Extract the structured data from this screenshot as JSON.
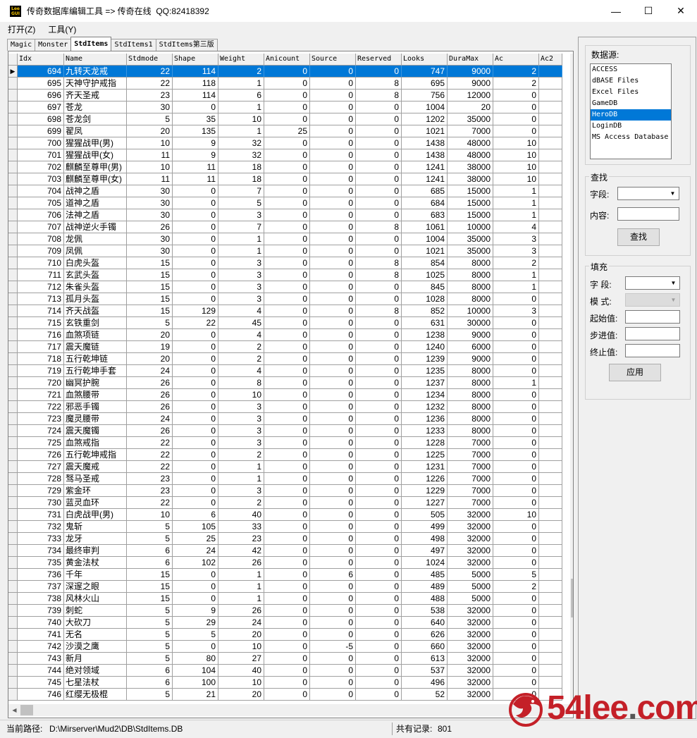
{
  "window": {
    "icon_text": "Lee\nGUI",
    "title": "传奇数据库编辑工具 => 传奇在线  QQ:82418392",
    "minimize": "—",
    "maximize": "☐",
    "close": "✕"
  },
  "menu": [
    "打开(Z)",
    "工具(Y)"
  ],
  "tabs": [
    {
      "label": "Magic",
      "active": false
    },
    {
      "label": "Monster",
      "active": false
    },
    {
      "label": "StdItems",
      "active": true
    },
    {
      "label": "StdItems1",
      "active": false
    },
    {
      "label": "StdItems第三版",
      "active": false
    }
  ],
  "grid": {
    "columns": [
      "Idx",
      "Name",
      "Stdmode",
      "Shape",
      "Weight",
      "Anicount",
      "Source",
      "Reserved",
      "Looks",
      "DuraMax",
      "Ac",
      "Ac2"
    ],
    "selected_row": 0,
    "rows": [
      [
        "694",
        "九转天龙戒",
        "22",
        "114",
        "2",
        "0",
        "0",
        "0",
        "747",
        "9000",
        "2"
      ],
      [
        "695",
        "天神守护戒指",
        "22",
        "118",
        "1",
        "0",
        "0",
        "8",
        "695",
        "9000",
        "2"
      ],
      [
        "696",
        "齐天圣戒",
        "23",
        "114",
        "6",
        "0",
        "0",
        "8",
        "756",
        "12000",
        "0"
      ],
      [
        "697",
        "苍龙",
        "30",
        "0",
        "1",
        "0",
        "0",
        "0",
        "1004",
        "20",
        "0"
      ],
      [
        "698",
        "苍龙剑",
        "5",
        "35",
        "10",
        "0",
        "0",
        "0",
        "1202",
        "35000",
        "0"
      ],
      [
        "699",
        "翟凤",
        "20",
        "135",
        "1",
        "25",
        "0",
        "0",
        "1021",
        "7000",
        "0"
      ],
      [
        "700",
        "猩猩战甲(男)",
        "10",
        "9",
        "32",
        "0",
        "0",
        "0",
        "1438",
        "48000",
        "10"
      ],
      [
        "701",
        "猩猩战甲(女)",
        "11",
        "9",
        "32",
        "0",
        "0",
        "0",
        "1438",
        "48000",
        "10"
      ],
      [
        "702",
        "麒麟至尊甲(男)",
        "10",
        "11",
        "18",
        "0",
        "0",
        "0",
        "1241",
        "38000",
        "10"
      ],
      [
        "703",
        "麒麟至尊甲(女)",
        "11",
        "11",
        "18",
        "0",
        "0",
        "0",
        "1241",
        "38000",
        "10"
      ],
      [
        "704",
        "战神之盾",
        "30",
        "0",
        "7",
        "0",
        "0",
        "0",
        "685",
        "15000",
        "1"
      ],
      [
        "705",
        "道神之盾",
        "30",
        "0",
        "5",
        "0",
        "0",
        "0",
        "684",
        "15000",
        "1"
      ],
      [
        "706",
        "法神之盾",
        "30",
        "0",
        "3",
        "0",
        "0",
        "0",
        "683",
        "15000",
        "1"
      ],
      [
        "707",
        "战神逆火手镯",
        "26",
        "0",
        "7",
        "0",
        "0",
        "8",
        "1061",
        "10000",
        "4"
      ],
      [
        "708",
        "龙佩",
        "30",
        "0",
        "1",
        "0",
        "0",
        "0",
        "1004",
        "35000",
        "3"
      ],
      [
        "709",
        "凤佩",
        "30",
        "0",
        "1",
        "0",
        "0",
        "0",
        "1021",
        "35000",
        "3"
      ],
      [
        "710",
        "白虎头盔",
        "15",
        "0",
        "3",
        "0",
        "0",
        "8",
        "854",
        "8000",
        "2"
      ],
      [
        "711",
        "玄武头盔",
        "15",
        "0",
        "3",
        "0",
        "0",
        "8",
        "1025",
        "8000",
        "1"
      ],
      [
        "712",
        "朱雀头盔",
        "15",
        "0",
        "3",
        "0",
        "0",
        "0",
        "845",
        "8000",
        "1"
      ],
      [
        "713",
        "孤月头盔",
        "15",
        "0",
        "3",
        "0",
        "0",
        "0",
        "1028",
        "8000",
        "0"
      ],
      [
        "714",
        "齐天战盔",
        "15",
        "129",
        "4",
        "0",
        "0",
        "8",
        "852",
        "10000",
        "3"
      ],
      [
        "715",
        "玄铁重剑",
        "5",
        "22",
        "45",
        "0",
        "0",
        "0",
        "631",
        "30000",
        "0"
      ],
      [
        "716",
        "血煞项链",
        "20",
        "0",
        "4",
        "0",
        "0",
        "0",
        "1238",
        "9000",
        "0"
      ],
      [
        "717",
        "震天魔链",
        "19",
        "0",
        "2",
        "0",
        "0",
        "0",
        "1240",
        "6000",
        "0"
      ],
      [
        "718",
        "五行乾坤链",
        "20",
        "0",
        "2",
        "0",
        "0",
        "0",
        "1239",
        "9000",
        "0"
      ],
      [
        "719",
        "五行乾坤手套",
        "24",
        "0",
        "4",
        "0",
        "0",
        "0",
        "1235",
        "8000",
        "0"
      ],
      [
        "720",
        "幽冥护腕",
        "26",
        "0",
        "8",
        "0",
        "0",
        "0",
        "1237",
        "8000",
        "1"
      ],
      [
        "721",
        "血煞腰带",
        "26",
        "0",
        "10",
        "0",
        "0",
        "0",
        "1234",
        "8000",
        "0"
      ],
      [
        "722",
        "邪恶手镯",
        "26",
        "0",
        "3",
        "0",
        "0",
        "0",
        "1232",
        "8000",
        "0"
      ],
      [
        "723",
        "魔灵腰带",
        "24",
        "0",
        "3",
        "0",
        "0",
        "0",
        "1236",
        "8000",
        "0"
      ],
      [
        "724",
        "震天魔镯",
        "26",
        "0",
        "3",
        "0",
        "0",
        "0",
        "1233",
        "8000",
        "0"
      ],
      [
        "725",
        "血煞戒指",
        "22",
        "0",
        "3",
        "0",
        "0",
        "0",
        "1228",
        "7000",
        "0"
      ],
      [
        "726",
        "五行乾坤戒指",
        "22",
        "0",
        "2",
        "0",
        "0",
        "0",
        "1225",
        "7000",
        "0"
      ],
      [
        "727",
        "震天魔戒",
        "22",
        "0",
        "1",
        "0",
        "0",
        "0",
        "1231",
        "7000",
        "0"
      ],
      [
        "728",
        "驽马圣戒",
        "23",
        "0",
        "1",
        "0",
        "0",
        "0",
        "1226",
        "7000",
        "0"
      ],
      [
        "729",
        "紫金环",
        "23",
        "0",
        "3",
        "0",
        "0",
        "0",
        "1229",
        "7000",
        "0"
      ],
      [
        "730",
        "蓝灵血环",
        "22",
        "0",
        "2",
        "0",
        "0",
        "0",
        "1227",
        "7000",
        "0"
      ],
      [
        "731",
        "白虎战甲(男)",
        "10",
        "6",
        "40",
        "0",
        "0",
        "0",
        "505",
        "32000",
        "10"
      ],
      [
        "732",
        "鬼斩",
        "5",
        "105",
        "33",
        "0",
        "0",
        "0",
        "499",
        "32000",
        "0"
      ],
      [
        "733",
        "龙牙",
        "5",
        "25",
        "23",
        "0",
        "0",
        "0",
        "498",
        "32000",
        "0"
      ],
      [
        "734",
        "最终审判",
        "6",
        "24",
        "42",
        "0",
        "0",
        "0",
        "497",
        "32000",
        "0"
      ],
      [
        "735",
        "黄金法杖",
        "6",
        "102",
        "26",
        "0",
        "0",
        "0",
        "1024",
        "32000",
        "0"
      ],
      [
        "736",
        "千年",
        "15",
        "0",
        "1",
        "0",
        "6",
        "0",
        "485",
        "5000",
        "5"
      ],
      [
        "737",
        "深邃之眼",
        "15",
        "0",
        "1",
        "0",
        "0",
        "0",
        "489",
        "5000",
        "2"
      ],
      [
        "738",
        "风林火山",
        "15",
        "0",
        "1",
        "0",
        "0",
        "0",
        "488",
        "5000",
        "0"
      ],
      [
        "739",
        "刺蛇",
        "5",
        "9",
        "26",
        "0",
        "0",
        "0",
        "538",
        "32000",
        "0"
      ],
      [
        "740",
        "大砍刀",
        "5",
        "29",
        "24",
        "0",
        "0",
        "0",
        "640",
        "32000",
        "0"
      ],
      [
        "741",
        "无名",
        "5",
        "5",
        "20",
        "0",
        "0",
        "0",
        "626",
        "32000",
        "0"
      ],
      [
        "742",
        "沙漠之鹰",
        "5",
        "0",
        "10",
        "0",
        "-5",
        "0",
        "660",
        "32000",
        "0"
      ],
      [
        "743",
        "新月",
        "5",
        "80",
        "27",
        "0",
        "0",
        "0",
        "613",
        "32000",
        "0"
      ],
      [
        "744",
        "绝对领域",
        "6",
        "104",
        "40",
        "0",
        "0",
        "0",
        "537",
        "32000",
        "0"
      ],
      [
        "745",
        "七星法杖",
        "6",
        "100",
        "10",
        "0",
        "0",
        "0",
        "496",
        "32000",
        "0"
      ],
      [
        "746",
        "红缨无极棍",
        "5",
        "21",
        "20",
        "0",
        "0",
        "0",
        "52",
        "32000",
        "0"
      ]
    ]
  },
  "datasource": {
    "title": "数据源:",
    "items": [
      "ACCESS",
      "dBASE Files",
      "Excel Files",
      "GameDB",
      "HeroDB",
      "LoginDB",
      "MS Access Database"
    ],
    "selected": 4
  },
  "search": {
    "title": "查找",
    "field_label": "字段:",
    "field_value": "",
    "content_label": "内容:",
    "content_value": "",
    "button": "查找"
  },
  "fill": {
    "title": "填充",
    "field_label": "字  段:",
    "mode_label": "模  式:",
    "start_label": "起始值:",
    "step_label": "步进值:",
    "end_label": "终止值:",
    "button": "应用"
  },
  "status": {
    "path_label": "当前路径:",
    "path": "D:\\Mirserver\\Mud2\\DB\\StdItems.DB",
    "count_label": "共有记录:",
    "count": "801"
  },
  "watermark": {
    "text_a": "54lee",
    "text_b": "com"
  },
  "colors": {
    "selection": "#0078d7",
    "watermark": "#c42028"
  }
}
